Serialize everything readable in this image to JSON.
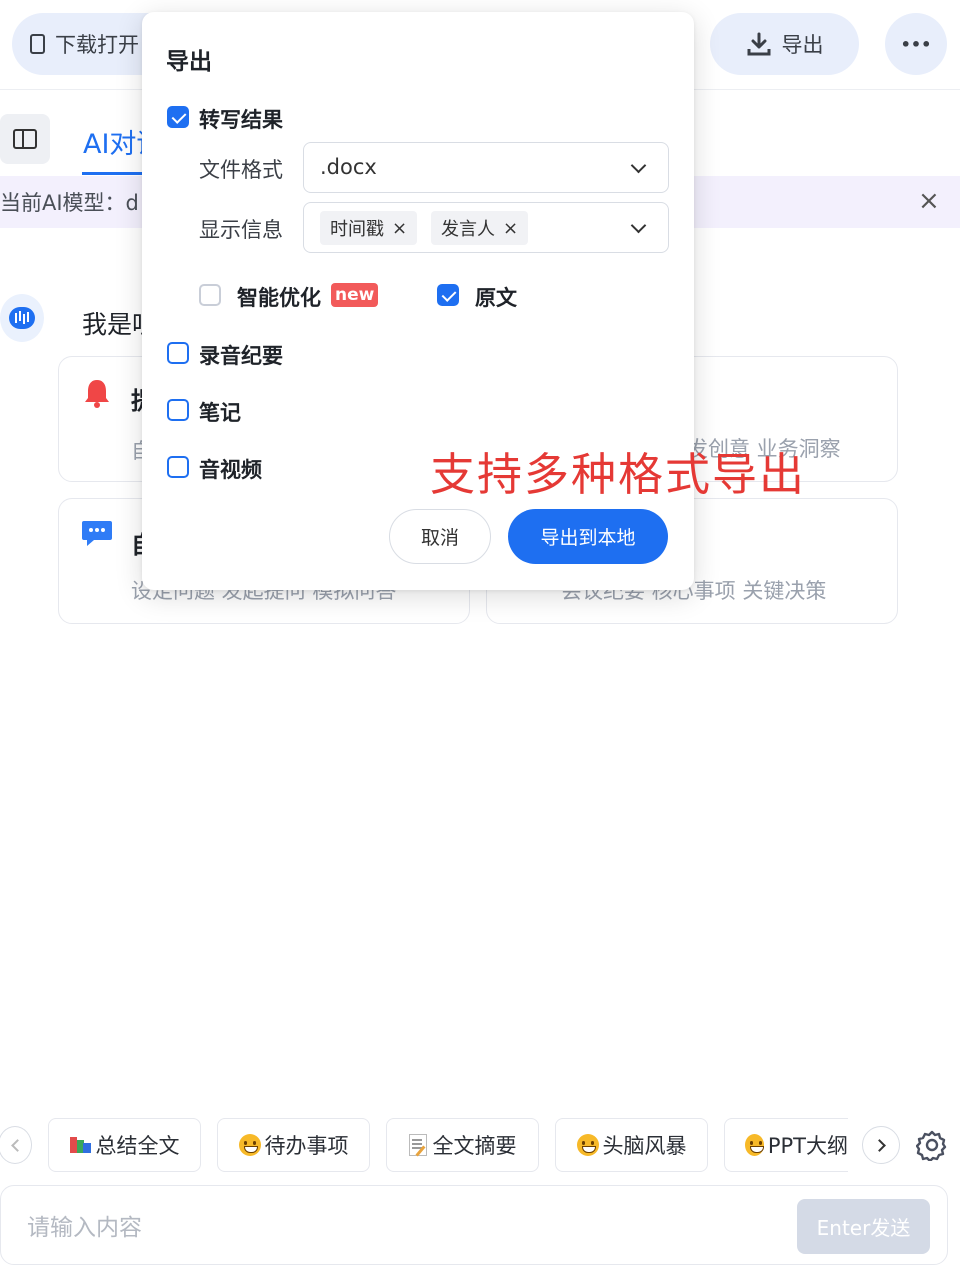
{
  "topbar": {
    "download_app_label": "下载打开",
    "export_label": "导出",
    "more_label": "•••"
  },
  "tabs": {
    "ai_tab_label": "AI对话"
  },
  "model_bar": {
    "text": "当前AI模型：d",
    "close": "×"
  },
  "assistant": {
    "greeting": "我是听"
  },
  "cards": [
    {
      "title": "提",
      "subtitle": "自"
    },
    {
      "title": "",
      "subtitle": "发创意 业务洞察"
    },
    {
      "title": "自",
      "subtitle": "设定问题 发起提问 模拟问答"
    },
    {
      "title": "",
      "subtitle": "会议纪要 核心事项 关键决策"
    }
  ],
  "export_dialog": {
    "title": "导出",
    "transcript": {
      "label": "转写结果",
      "checked": true
    },
    "format_label": "文件格式",
    "format_value": ".docx",
    "display_info_label": "显示信息",
    "display_tags": [
      "时间戳",
      "发言人"
    ],
    "tag_remove": "×",
    "smart_optimize": {
      "label": "智能优化",
      "badge": "new",
      "checked": false
    },
    "original_text": {
      "label": "原文",
      "checked": true
    },
    "recording_summary": {
      "label": "录音纪要",
      "checked": false
    },
    "notes": {
      "label": "笔记",
      "checked": false
    },
    "audio_video": {
      "label": "音视频",
      "checked": false
    },
    "cancel_label": "取消",
    "export_local_label": "导出到本地"
  },
  "annotation": "支持多种格式导出",
  "shortcuts": [
    {
      "icon": "books-icon",
      "label": "总结全文"
    },
    {
      "icon": "grin-emoji-icon",
      "label": "待办事项"
    },
    {
      "icon": "memo-icon",
      "label": "全文摘要"
    },
    {
      "icon": "grin-emoji-icon",
      "label": "头脑风暴"
    },
    {
      "icon": "grin-emoji-icon",
      "label": "PPT大纲"
    }
  ],
  "composer": {
    "placeholder": "请输入内容",
    "send_label": "Enter发送"
  },
  "colors": {
    "primary": "#1e6ff1",
    "annotation": "#e53935",
    "pill_bg": "#e8eefb",
    "model_bar_bg": "#f3f0fd",
    "badge": "#f25a5a"
  }
}
